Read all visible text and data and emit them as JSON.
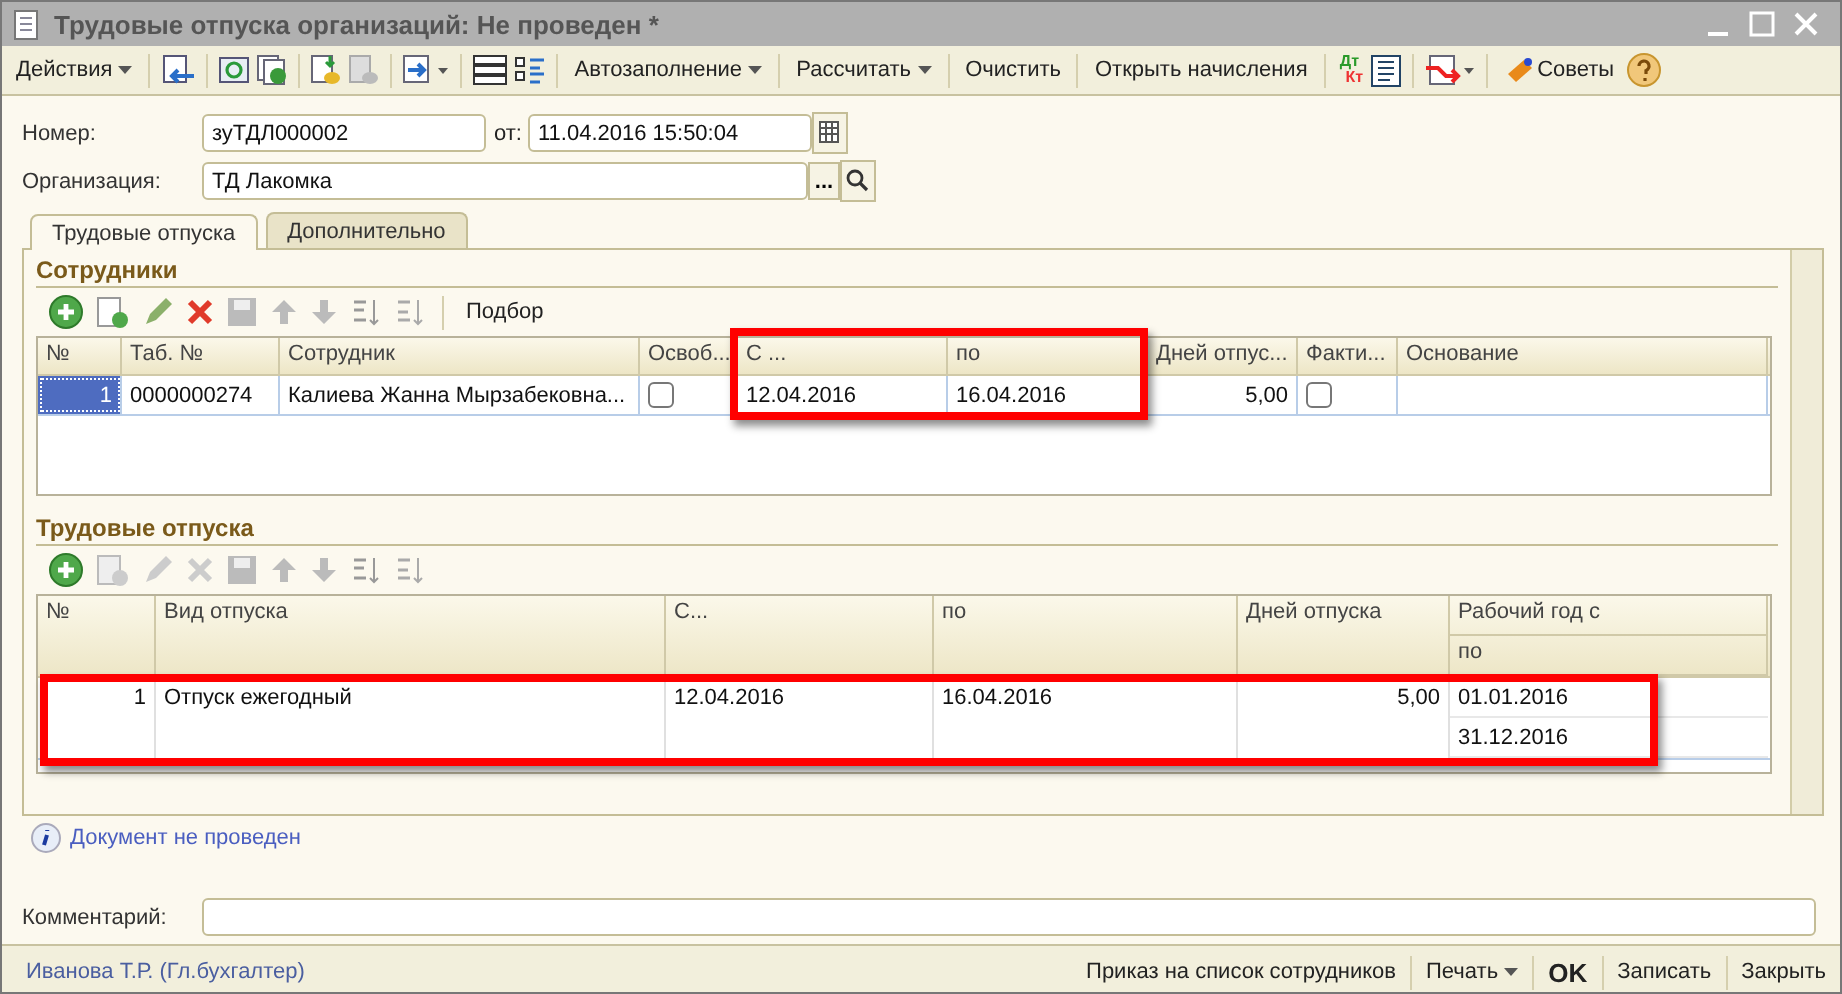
{
  "window": {
    "title": "Трудовые отпуска организаций: Не проведен *"
  },
  "toolbar": {
    "actions": "Действия",
    "autofill": "Автозаполнение",
    "calculate": "Рассчитать",
    "clear": "Очистить",
    "open_accruals": "Открыть начисления",
    "debit": "Дт",
    "credit": "Кт",
    "tips": "Советы"
  },
  "form": {
    "number_label": "Номер:",
    "number": "зуТДЛ000002",
    "date_label": "от:",
    "date": "11.04.2016 15:50:04",
    "org_label": "Организация:",
    "org": "ТД Лакомка",
    "org_button": "..."
  },
  "tabs": [
    {
      "label": "Трудовые отпуска",
      "selected": true
    },
    {
      "label": "Дополнительно",
      "selected": false
    }
  ],
  "employees": {
    "title": "Сотрудники",
    "pick": "Подбор",
    "actions_enabled": true,
    "columns": [
      "№",
      "Таб. №",
      "Сотрудник",
      "Освоб...",
      "С ...",
      "по",
      "Дней отпус...",
      "Факти...",
      "Основание"
    ],
    "rows": [
      {
        "selected": true,
        "dates_highlighted": true,
        "number": "1",
        "tab_number": "0000000274",
        "employee": "Калиева Жанна Мырзабековна...",
        "exempt": false,
        "from": "12.04.2016",
        "to": "16.04.2016",
        "days": "5,00",
        "actual": false
      }
    ]
  },
  "vacations": {
    "title": "Трудовые отпуска",
    "actions_enabled": false,
    "columns": [
      "№",
      "Вид отпуска",
      "С...",
      "по",
      "Дней отпуска"
    ],
    "year_from": "Рабочий год с",
    "year_to": "по",
    "rows": [
      {
        "highlighted": true,
        "number": "1",
        "kind": "Отпуск ежегодный",
        "from": "12.04.2016",
        "to": "16.04.2016",
        "days": "5,00",
        "year_from": "01.01.2016",
        "year_to": "31.12.2016"
      }
    ]
  },
  "info": "Документ не проведен",
  "comment_label": "Комментарий:",
  "footer": {
    "user": "Иванова Т.Р. (Гл.бухгалтер)",
    "order": "Приказ на список сотрудников",
    "print": "Печать",
    "ok": "OK",
    "save": "Записать",
    "close": "Закрыть"
  }
}
